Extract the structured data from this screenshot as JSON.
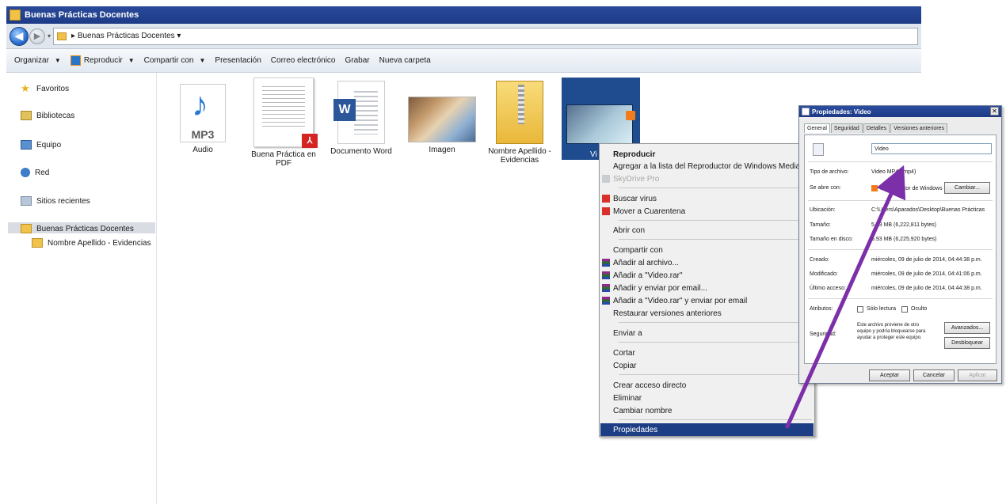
{
  "window": {
    "title": "Buenas Prácticas Docentes"
  },
  "address": {
    "path": "▸ Buenas Prácticas Docentes ▾"
  },
  "toolbar": {
    "organize": "Organizar",
    "play": "Reproducir",
    "share": "Compartir con",
    "slideshow": "Presentación",
    "email": "Correo electrónico",
    "burn": "Grabar",
    "new_folder": "Nueva carpeta"
  },
  "nav": {
    "favorites": "Favoritos",
    "libraries": "Bibliotecas",
    "computer": "Equipo",
    "network": "Red",
    "recent": "Sitios recientes",
    "current_folder": "Buenas Prácticas Docentes",
    "subfolder": "Nombre Apellido - Evidencias"
  },
  "files": [
    {
      "name": "Audio",
      "icon": "mp3-icon",
      "badge": "MP3"
    },
    {
      "name": "Buena Práctica en PDF",
      "icon": "pdf-icon"
    },
    {
      "name": "Documento Word",
      "icon": "word-icon",
      "badge": "W"
    },
    {
      "name": "Imagen",
      "icon": "image-icon"
    },
    {
      "name": "Nombre Apellido - Evidencias",
      "icon": "zip-folder-icon"
    },
    {
      "name": "Vi",
      "icon": "video-icon"
    }
  ],
  "context_menu": {
    "items": [
      "Reproducir",
      "Agregar a la lista del Reproductor de Windows Media",
      "SkyDrive Pro",
      "Buscar virus",
      "Mover a Cuarentena",
      "Abrir con",
      "Compartir con",
      "Añadir al archivo...",
      "Añadir a \"Video.rar\"",
      "Añadir y enviar por email...",
      "Añadir a \"Video.rar\" y enviar por email",
      "Restaurar versiones anteriores",
      "Enviar a",
      "Cortar",
      "Copiar",
      "Crear acceso directo",
      "Eliminar",
      "Cambiar nombre",
      "Propiedades"
    ]
  },
  "properties": {
    "title": "Propiedades: Video",
    "tabs": [
      "General",
      "Seguridad",
      "Detalles",
      "Versiones anteriores"
    ],
    "name_value": "Video",
    "labels": {
      "type": "Tipo de archivo:",
      "opens_with": "Se abre con:",
      "location": "Ubicación:",
      "size": "Tamaño:",
      "size_on_disk": "Tamaño en disco:",
      "created": "Creado:",
      "modified": "Modificado:",
      "accessed": "Último acceso:",
      "attributes": "Atributos:",
      "security": "Seguridad:"
    },
    "values": {
      "type": "Video MP4 (.mp4)",
      "opens_with": "Reproductor de Windows",
      "location": "C:\\Users\\Aparados\\Desktop\\Buenas Prácticas",
      "size": "5.93 MB (6,222,811 bytes)",
      "size_on_disk": "5.93 MB (6,225,920 bytes)",
      "created": "miércoles, 09 de julio de 2014, 04:44:38 p.m.",
      "modified": "miércoles, 09 de julio de 2014, 04:41:06 p.m.",
      "accessed": "miércoles, 09 de julio de 2014, 04:44:38 p.m."
    },
    "readonly": "Sólo lectura",
    "hidden": "Oculto",
    "security_text_1": "Este archivo proviene de otro",
    "security_text_2": "equipo y podría bloquearse para",
    "security_text_3": "ayudar a proteger este equipo.",
    "buttons": {
      "change": "Cambiar...",
      "advanced": "Avanzados...",
      "unblock": "Desbloquear",
      "ok": "Aceptar",
      "cancel": "Cancelar",
      "apply": "Aplicar"
    }
  },
  "colors": {
    "menu_highlight": "#1d3e84",
    "arrow": "#7b2fa8"
  }
}
